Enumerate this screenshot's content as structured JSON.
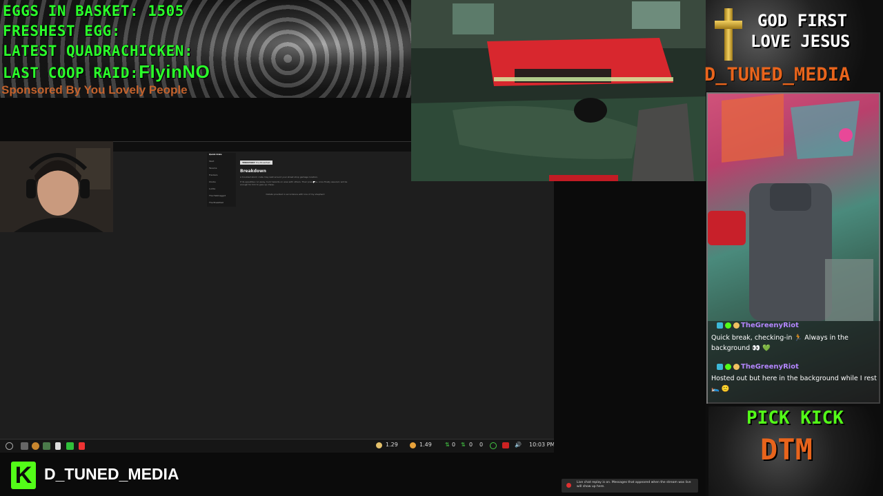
{
  "overlay": {
    "eggs_label": "EGGS IN BASKET: 1505",
    "freshest_label": "FRESHEST EGG:",
    "quadrachicken_label": "LATEST QUADRACHICKEN:",
    "coop_raid_label": "LAST COOP RAID:",
    "coop_raid_name": "FlyinNO",
    "sponsor": "Sponsored By You Lovely People"
  },
  "website": {
    "nav_title": "Quick links",
    "nav_items": [
      "Start",
      "Taverns",
      "Trackers",
      "Clocks",
      "Lurkle",
      "The Hallmaggot",
      "The Breakfast"
    ],
    "tag": "TERRITORY",
    "tag2": "The Breakfast",
    "heading": "Breakdown",
    "para1": "A troubled storm crate may wait around your street shop garbage location.",
    "para2": "If its appetites run away, tuck hazards on area with others. Their presence, once finally assured, will be enough for him to give up chase.",
    "footer": "Details provided in accordance with lore of my shepherd"
  },
  "taskbar": {
    "time": "10:03 PM",
    "stat1": "1.29",
    "stat2": "1.49",
    "net1": "0",
    "net2": "0",
    "net3": "0"
  },
  "brand": {
    "kick_letter": "K",
    "channel_name": "D_TUNED_MEDIA"
  },
  "right_panel": {
    "god_line1": "GOD FIRST",
    "god_line2": "LOVE JESUS",
    "channel_title": "D_TUNED_MEDIA",
    "pick_kick": "PICK KICK",
    "dtm": "DTM"
  },
  "chat": {
    "messages": [
      {
        "user": "TheGreenyRiot",
        "text": "Quick break, checking-in 🏃 Always in the background 👀 💚"
      },
      {
        "user": "TheGreenyRiot",
        "text": "Hosted out but here in the background while I rest 🛌 🙂"
      }
    ]
  },
  "replay_notice": "Live chat replay is on. Messages that appeared when the stream was live will show up here.",
  "colors": {
    "overlay_green": "#2bff2b",
    "orange": "#e8641c",
    "kick_green": "#53fc18",
    "chat_user": "#b486ff"
  }
}
